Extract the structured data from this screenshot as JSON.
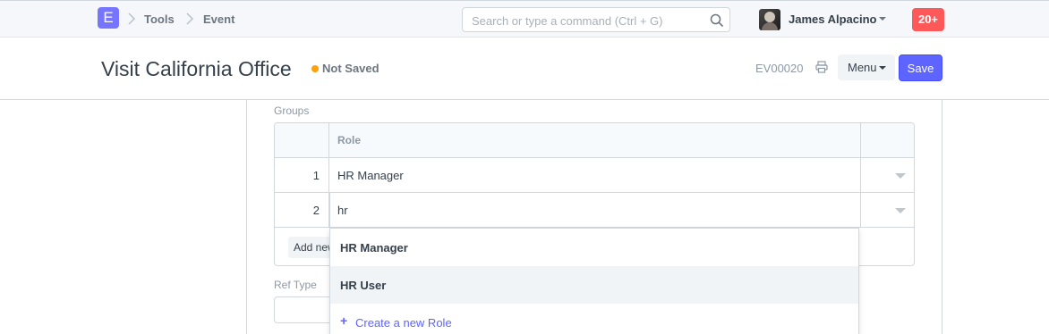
{
  "navbar": {
    "logo_letter": "E",
    "breadcrumbs": [
      "Tools",
      "Event"
    ],
    "search_placeholder": "Search or type a command (Ctrl + G)",
    "user_name": "James Alpacino",
    "notification_count": "20+"
  },
  "page_head": {
    "title": "Visit California Office",
    "status": "Not Saved",
    "doc_id": "EV00020",
    "menu_label": "Menu",
    "save_label": "Save"
  },
  "form": {
    "groups_label": "Groups",
    "grid": {
      "column_header": "Role",
      "rows": [
        {
          "idx": "1",
          "value": "HR Manager"
        },
        {
          "idx": "2",
          "value": "hr"
        }
      ],
      "add_row_label": "Add new row"
    },
    "ref_type_label": "Ref Type"
  },
  "dropdown": {
    "options": [
      "HR Manager",
      "HR User"
    ],
    "active_index": 1,
    "create_label": "Create a new Role"
  },
  "colors": {
    "primary": "#5e64ff",
    "notification": "#ff5858",
    "status_not_saved": "#ffa00a",
    "logo": "#7575ff"
  }
}
